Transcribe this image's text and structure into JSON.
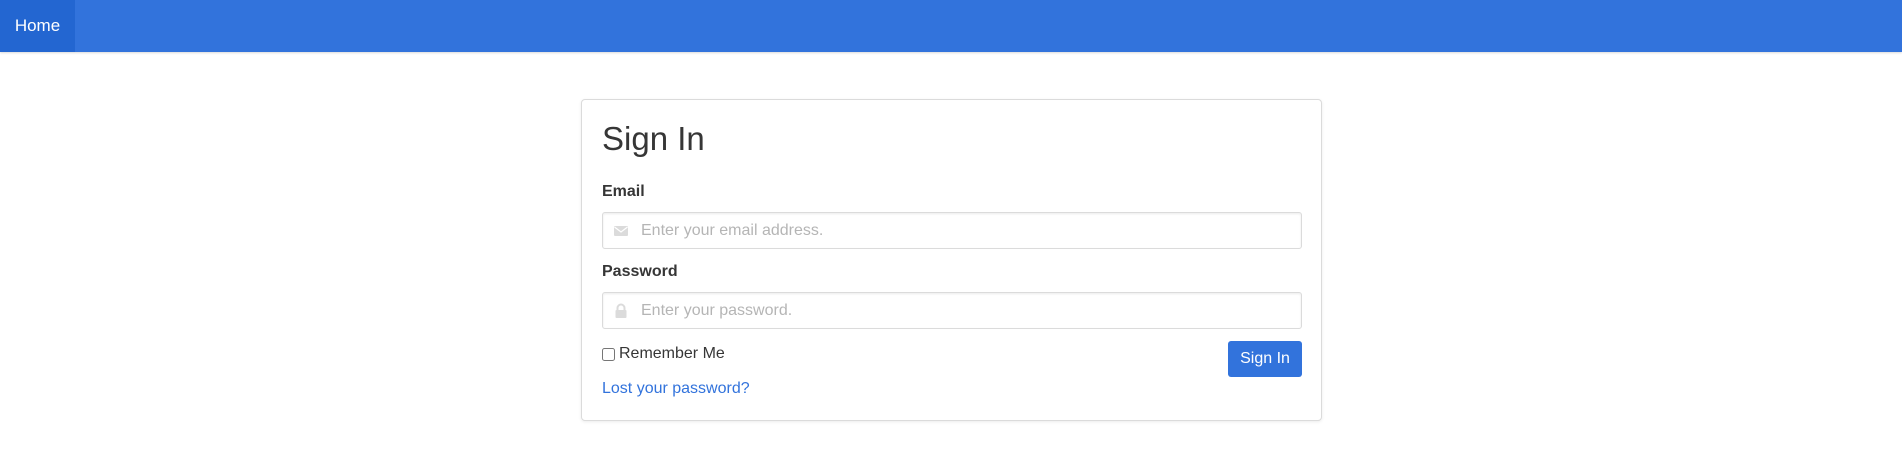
{
  "nav": {
    "home_label": "Home",
    "bar_color": "#3273dc"
  },
  "signin": {
    "title": "Sign In",
    "email": {
      "label": "Email",
      "placeholder": "Enter your email address.",
      "value": "",
      "icon": "envelope-icon"
    },
    "password": {
      "label": "Password",
      "placeholder": "Enter your password.",
      "value": "",
      "icon": "lock-icon"
    },
    "remember_label": "Remember Me",
    "remember_checked": false,
    "submit_label": "Sign In",
    "lost_password_label": "Lost your password?"
  }
}
